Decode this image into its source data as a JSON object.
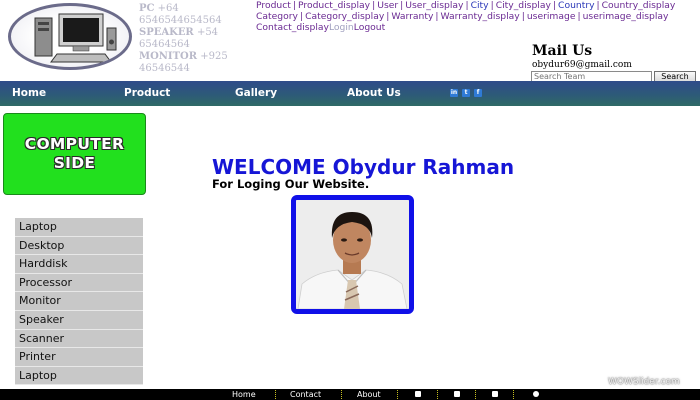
{
  "contacts": {
    "pc_label": "PC",
    "pc_number": "+64 6546544654564",
    "speaker_label": "SPEAKER",
    "speaker_number": "+54 65464564",
    "monitor_label": "MONITOR",
    "monitor_number": "+925 46546544"
  },
  "admin_links": [
    {
      "label": "Product",
      "tone": "purple"
    },
    {
      "label": "Product_display",
      "tone": "purple"
    },
    {
      "label": "User",
      "tone": "purple"
    },
    {
      "label": "User_display",
      "tone": "purple"
    },
    {
      "label": "City",
      "tone": "blue"
    },
    {
      "label": "City_display",
      "tone": "purple"
    },
    {
      "label": "Country",
      "tone": "blue"
    },
    {
      "label": "Country_display",
      "tone": "purple"
    },
    {
      "label": "Category",
      "tone": "purple"
    },
    {
      "label": "Category_display",
      "tone": "purple"
    },
    {
      "label": "Warranty",
      "tone": "purple"
    },
    {
      "label": "Warranty_display",
      "tone": "purple"
    },
    {
      "label": "userimage",
      "tone": "purple"
    },
    {
      "label": "userimage_display",
      "tone": "purple"
    },
    {
      "label": "Contact_display",
      "tone": "purple"
    },
    {
      "label": "Login",
      "tone": "grey"
    },
    {
      "label": "Logout",
      "tone": "purple"
    }
  ],
  "mail": {
    "title": "Mail Us",
    "address": "obydur69@gmail.com"
  },
  "search": {
    "placeholder": "Search Team",
    "button_label": "Search"
  },
  "nav": {
    "items": [
      "Home",
      "Product",
      "Gallery",
      "About Us"
    ],
    "social_icons": [
      "linkedin-icon",
      "twitter-icon",
      "facebook-icon"
    ]
  },
  "brand": {
    "line1": "COMPUTER",
    "line2": "SIDE"
  },
  "categories": [
    "Laptop",
    "Desktop",
    "Harddisk",
    "Processor",
    "Monitor",
    "Speaker",
    "Scanner",
    "Printer",
    "Laptop"
  ],
  "welcome": {
    "title": "WELCOME Obydur Rahman",
    "subtitle": "For Loging Our Website."
  },
  "footer": {
    "items": [
      "Home",
      "Contact",
      "About"
    ],
    "icons": [
      "facebook-icon",
      "twitter-icon",
      "youtube-icon",
      "wechat-icon"
    ],
    "credit": "WOWSlider.com"
  },
  "colors": {
    "nav_gradient_top": "#2f4b8a",
    "nav_gradient_bottom": "#2f6a66",
    "brand_green": "#22e01e",
    "welcome_blue": "#1616d6",
    "photo_border": "#1010e8",
    "sidebar_item_bg": "#c8c8c8"
  }
}
